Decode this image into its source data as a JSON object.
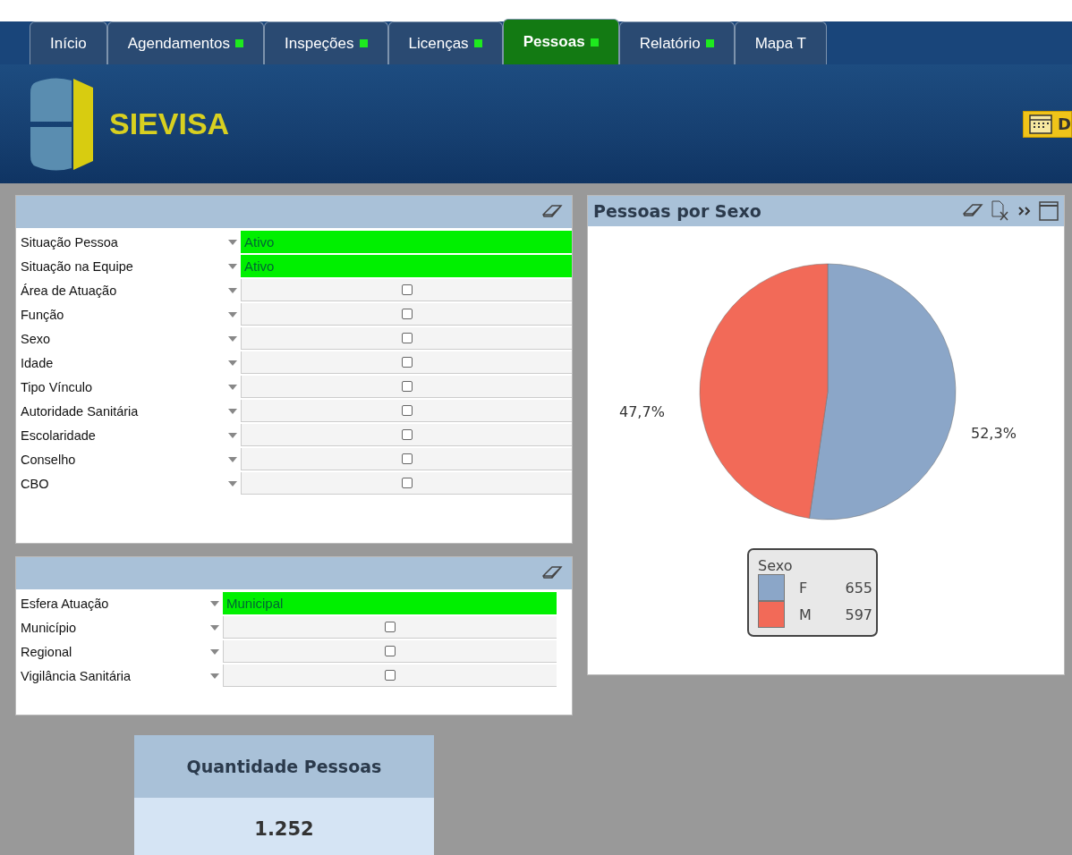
{
  "tabs": [
    {
      "label": "Início",
      "selected": false,
      "indicator": false
    },
    {
      "label": "Agendamentos",
      "selected": false,
      "indicator": true
    },
    {
      "label": "Inspeções",
      "selected": false,
      "indicator": true
    },
    {
      "label": "Licenças",
      "selected": false,
      "indicator": true
    },
    {
      "label": "Pessoas",
      "selected": true,
      "indicator": true
    },
    {
      "label": "Relatório",
      "selected": false,
      "indicator": true
    },
    {
      "label": "Mapa T",
      "selected": false,
      "indicator": false
    }
  ],
  "header": {
    "logo_text": "SIEVISA",
    "button_label": "D"
  },
  "filter_panels": [
    {
      "rows": [
        {
          "label": "Situação Pessoa",
          "value": "Ativo",
          "selected": true
        },
        {
          "label": "Situação na Equipe",
          "value": "Ativo",
          "selected": true
        },
        {
          "label": "Área de Atuação",
          "selected": false
        },
        {
          "label": "Função",
          "selected": false
        },
        {
          "label": "Sexo",
          "selected": false
        },
        {
          "label": "Idade",
          "selected": false
        },
        {
          "label": "Tipo Vínculo",
          "selected": false
        },
        {
          "label": "Autoridade Sanitária",
          "selected": false
        },
        {
          "label": "Escolaridade",
          "selected": false
        },
        {
          "label": "Conselho",
          "selected": false
        },
        {
          "label": "CBO",
          "selected": false
        }
      ]
    },
    {
      "rows": [
        {
          "label": "Esfera Atuação",
          "value": "Municipal",
          "selected": true
        },
        {
          "label": "Município",
          "selected": false
        },
        {
          "label": "Regional",
          "selected": false
        },
        {
          "label": "Vigilância Sanitária",
          "selected": false
        }
      ]
    }
  ],
  "chart_panel": {
    "title": "Pessoas por Sexo",
    "legend_title": "Sexo",
    "legend": [
      {
        "count": "655",
        "color": "#8ba6c8"
      },
      {
        "count": "597",
        "color": "#f26a58"
      }
    ],
    "chart_data": {
      "type": "pie",
      "categories": [
        "F",
        "M"
      ],
      "values": [
        52.3,
        47.7
      ],
      "value_labels": [
        "52,3%",
        "47,7%"
      ]
    }
  },
  "kpi": {
    "title": "Quantidade Pessoas",
    "value": "1.252"
  }
}
